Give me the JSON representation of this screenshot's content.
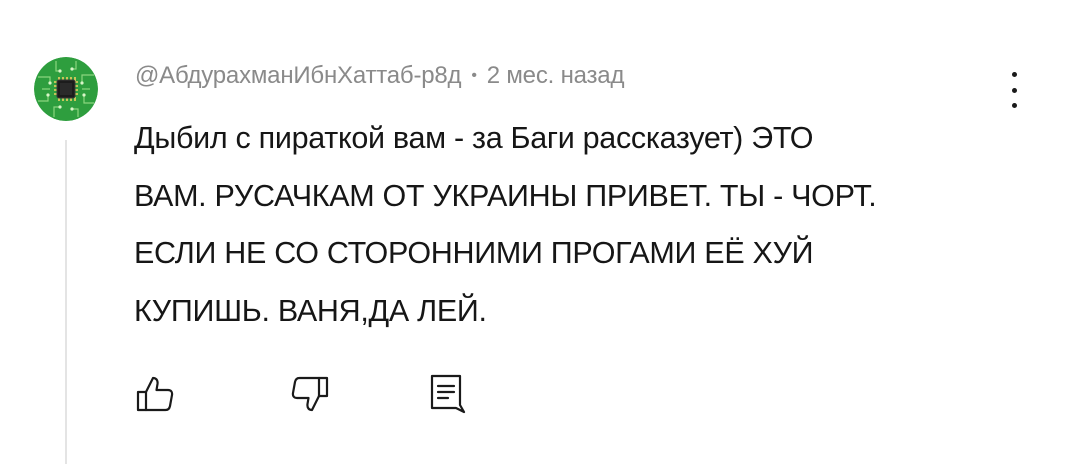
{
  "comment": {
    "author": "@АбдурахманИбнХаттаб-р8д",
    "separator": "•",
    "time": "2 мес. назад",
    "lines": [
      "Дыбил с пираткой вам - за Баги рассказует) ЭТО",
      "ВАМ. РУСАЧКАМ ОТ УКРАИНЫ ПРИВЕТ. ТЫ - ЧОРТ.",
      "ЕСЛИ НЕ СО СТОРОННИМИ ПРОГАМИ ЕЁ ХУЙ",
      "КУПИШЬ. ВАНЯ,ДА ЛЕЙ."
    ]
  },
  "icons": {
    "avatar": "green-circuit-chip-avatar",
    "more": "more-vertical-icon",
    "like": "thumbs-up-icon",
    "dislike": "thumbs-down-icon",
    "reply": "reply-comment-icon"
  },
  "colors": {
    "meta_text": "#8a8a8a",
    "body_text": "#161616",
    "avatar_green": "#2e9e3e"
  }
}
